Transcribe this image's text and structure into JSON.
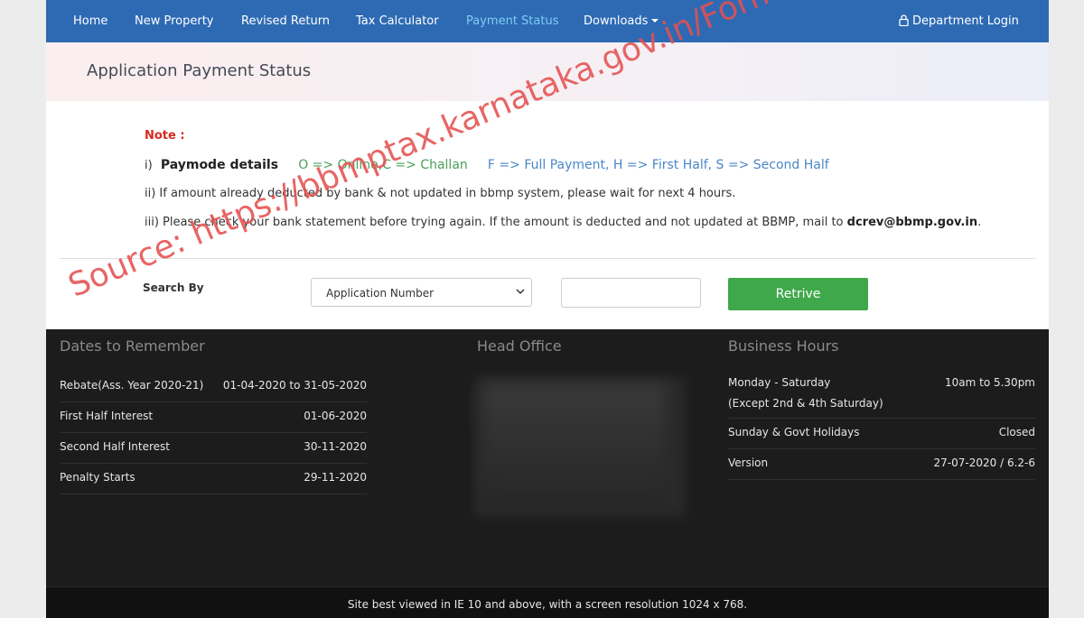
{
  "nav": {
    "items": [
      {
        "label": "Home",
        "active": false
      },
      {
        "label": "New Property",
        "active": false
      },
      {
        "label": "Revised Return",
        "active": false
      },
      {
        "label": "Tax Calculator",
        "active": false
      },
      {
        "label": "Payment Status",
        "active": true
      },
      {
        "label": "Downloads",
        "active": false,
        "dropdown": true
      }
    ],
    "department_login": "Department Login"
  },
  "page": {
    "title": "Application Payment Status"
  },
  "note": {
    "label": "Note :",
    "line1_prefix": "i)",
    "line1_bold": "Paymode details",
    "line1_mode": "O => Online,C => Challan",
    "line1_payment": "F => Full Payment, H => First Half, S => Second Half",
    "line2": "ii) If amount already deducted by bank & not updated in bbmp system, please wait for next 4 hours.",
    "line3_text": "iii) Please check your bank statement before trying again. If the amount is deducted and not updated at BBMP, mail to",
    "line3_email": "dcrev@bbmp.gov.in",
    "line3_end": "."
  },
  "search": {
    "label": "Search By",
    "selected_option": "Application Number",
    "input_value": "",
    "button_label": "Retrive"
  },
  "footer": {
    "dates_heading": "Dates to Remember",
    "dates": [
      {
        "label": "Rebate(Ass. Year 2020-21)",
        "value": "01-04-2020 to 31-05-2020"
      },
      {
        "label": "First Half Interest",
        "value": "01-06-2020"
      },
      {
        "label": "Second Half Interest",
        "value": "30-11-2020"
      },
      {
        "label": "Penalty Starts",
        "value": "29-11-2020"
      }
    ],
    "office_heading": "Head Office",
    "hours_heading": "Business Hours",
    "hours": {
      "weekday_label": "Monday - Saturday",
      "weekday_note": "(Except 2nd & 4th Saturday)",
      "weekday_value": "10am to 5.30pm",
      "holiday_label": "Sunday & Govt Holidays",
      "holiday_value": "Closed",
      "version_label": "Version",
      "version_value": "27-07-2020 / 6.2-6"
    },
    "bottom_text": "Site best viewed in IE 10 and above, with a screen resolution 1024 x 768."
  },
  "watermark": "Source: https://bbmptax.karnataka.gov.in/Forms/continuepayment.aspx",
  "colors": {
    "nav_bg": "#2d6ab3",
    "nav_active": "#7fcdf2",
    "button": "#3fa84a",
    "footer_bg": "#1c1c1c",
    "note_red": "#d9291c"
  }
}
